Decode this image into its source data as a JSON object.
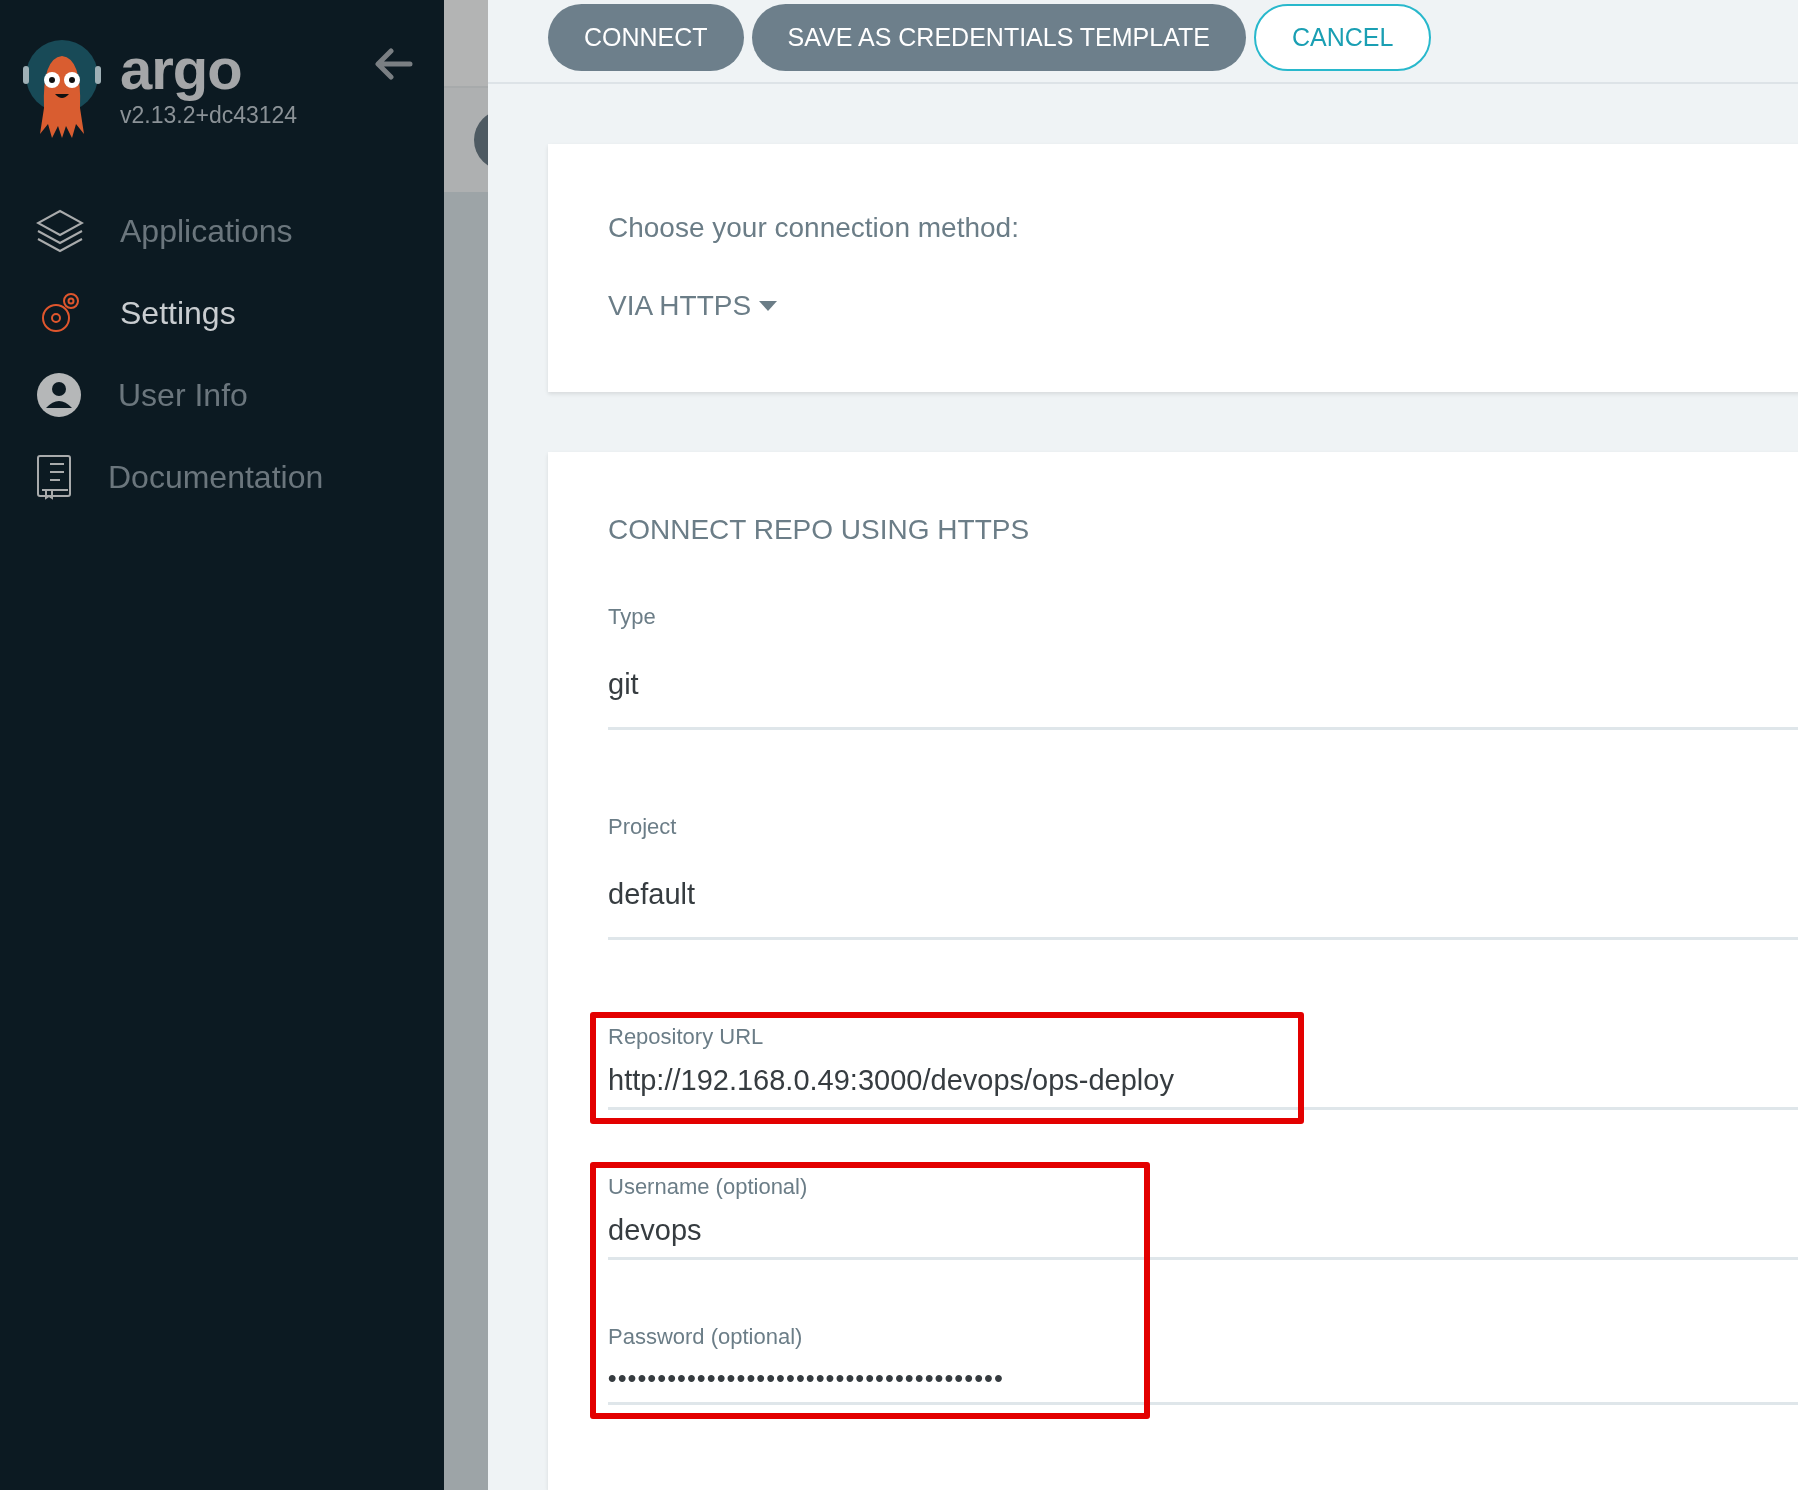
{
  "sidebar": {
    "brand": "argo",
    "version": "v2.13.2+dc43124",
    "items": [
      {
        "kind": "applications",
        "label": "Applications",
        "selected": false
      },
      {
        "kind": "settings",
        "label": "Settings",
        "selected": true
      },
      {
        "kind": "user",
        "label": "User Info",
        "selected": false
      },
      {
        "kind": "docs",
        "label": "Documentation",
        "selected": false
      }
    ]
  },
  "toolbar": {
    "buttons": [
      {
        "label": "CONNECT",
        "kind": "filled"
      },
      {
        "label": "SAVE AS CREDENTIALS TEMPLATE",
        "kind": "filled"
      },
      {
        "label": "CANCEL",
        "kind": "outline"
      }
    ]
  },
  "method_card": {
    "prompt": "Choose your connection method:",
    "method": "VIA HTTPS"
  },
  "form_card": {
    "title": "CONNECT REPO USING HTTPS",
    "groups": [
      {
        "fields": [
          {
            "label": "Type",
            "value": "git",
            "kind": "select"
          },
          {
            "label": "Project",
            "value": "default",
            "kind": "select"
          }
        ]
      },
      {
        "highlighted": true,
        "fields": [
          {
            "label": "Repository URL",
            "value": "http://192.168.0.49:3000/devops/ops-deploy",
            "kind": "input"
          }
        ]
      },
      {
        "highlighted": true,
        "fields": [
          {
            "label": "Username (optional)",
            "value": "devops",
            "kind": "input"
          },
          {
            "label": "Password (optional)",
            "value": "••••••••••••••••••••••••••••••••••••••••",
            "kind": "password"
          }
        ]
      }
    ]
  }
}
